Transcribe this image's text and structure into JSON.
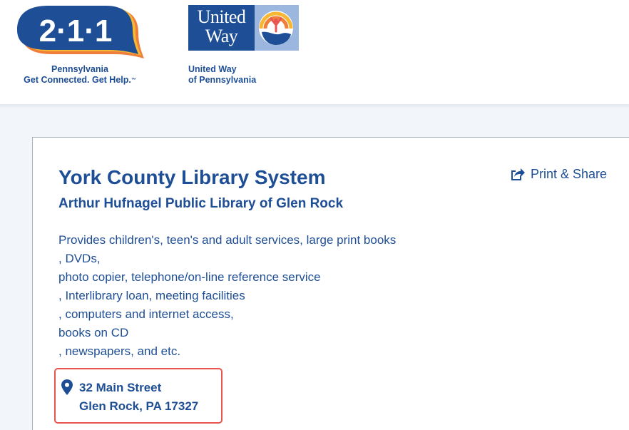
{
  "header": {
    "logo_211": {
      "digits": "2·1·1",
      "caption_line1": "Pennsylvania",
      "caption_line2": "Get Connected. Get Help.",
      "trademark": "™"
    },
    "logo_united_way": {
      "word1": "United",
      "word2": "Way",
      "caption_line1": "United Way",
      "caption_line2": "of Pennsylvania"
    }
  },
  "listing": {
    "title": "York County Library System",
    "subtitle": "Arthur Hufnagel Public Library of Glen Rock",
    "print_share_label": "Print & Share",
    "description_lines": [
      "Provides children's, teen's and adult services, large print books",
      ", DVDs,",
      "photo copier, telephone/on-line reference service",
      ", Interlibrary loan, meeting facilities",
      ", computers and internet access,",
      "books on CD",
      ", newspapers, and etc."
    ],
    "address": {
      "street": "32 Main Street",
      "city_state_zip": "Glen Rock, PA 17327"
    }
  },
  "icons": {
    "pin": "map-pin-icon",
    "share": "share-icon"
  },
  "colors": {
    "brand_blue": "#1e4e95",
    "highlight_red": "#e8554e",
    "logo_orange": "#ef7e3a",
    "logo_yellow": "#f7b733"
  }
}
